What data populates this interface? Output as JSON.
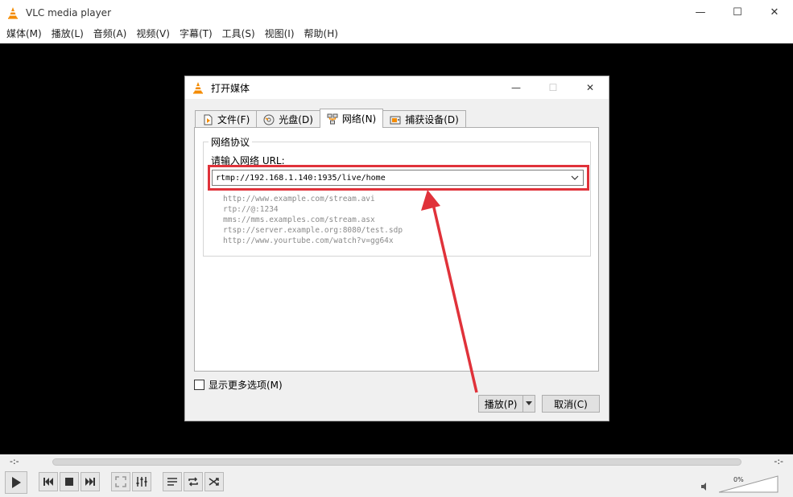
{
  "window": {
    "title": "VLC media player",
    "controls": {
      "minimize": "—",
      "maximize": "☐",
      "close": "✕"
    }
  },
  "menu": [
    "媒体(M)",
    "播放(L)",
    "音频(A)",
    "视频(V)",
    "字幕(T)",
    "工具(S)",
    "视图(I)",
    "帮助(H)"
  ],
  "dialog": {
    "title": "打开媒体",
    "controls": {
      "minimize": "—",
      "maximize": "☐",
      "close": "✕"
    },
    "tabs": [
      {
        "label": "文件(F)",
        "icon": "file-icon",
        "active": false
      },
      {
        "label": "光盘(D)",
        "icon": "disc-icon",
        "active": false
      },
      {
        "label": "网络(N)",
        "icon": "network-icon",
        "active": true
      },
      {
        "label": "捕获设备(D)",
        "icon": "capture-icon",
        "active": false
      }
    ],
    "group_title": "网络协议",
    "url_label": "请输入网络 URL:",
    "url_value": "rtmp://192.168.1.140:1935/live/home",
    "examples": [
      "http://www.example.com/stream.avi",
      "rtp://@:1234",
      "mms://mms.examples.com/stream.asx",
      "rtsp://server.example.org:8080/test.sdp",
      "http://www.yourtube.com/watch?v=gg64x"
    ],
    "more_options": "显示更多选项(M)",
    "play_button": "播放(P)",
    "cancel_button": "取消(C)"
  },
  "player": {
    "time_elapsed": "-:-",
    "time_remaining": "-:-",
    "volume": "0%"
  },
  "colors": {
    "highlight": "#e0323a",
    "vlc_orange": "#f48b00"
  }
}
